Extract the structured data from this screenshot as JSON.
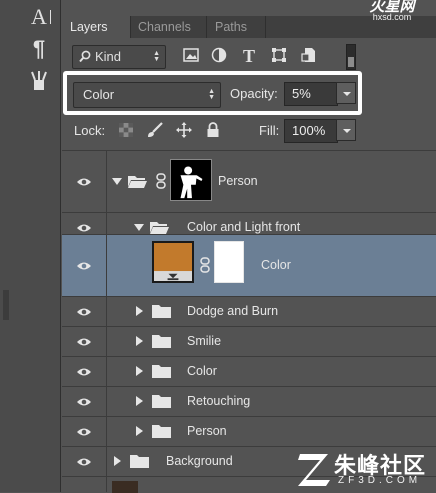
{
  "tools": [
    {
      "name": "type-tool",
      "glyph": "A"
    },
    {
      "name": "paragraph-tool",
      "glyph": "¶"
    },
    {
      "name": "brush-settings-tool",
      "glyph": ""
    }
  ],
  "tabs": [
    {
      "label": "Layers",
      "active": true
    },
    {
      "label": "Channels",
      "active": false
    },
    {
      "label": "Paths",
      "active": false
    }
  ],
  "filter": {
    "kind_label": "Kind",
    "icons": [
      "image-filter-icon",
      "adjustment-filter-icon",
      "type-filter-icon",
      "shape-filter-icon",
      "smart-object-filter-icon"
    ],
    "type_glyph": "T"
  },
  "blend": {
    "mode": "Color",
    "opacity_label": "Opacity:",
    "opacity_value": "5%"
  },
  "lock": {
    "label": "Lock:",
    "fill_label": "Fill:",
    "fill_value": "100%"
  },
  "layers": [
    {
      "name": "Person",
      "kind": "group",
      "expanded": true,
      "level": 0,
      "has_mask": true
    },
    {
      "name": "Color and Light front",
      "kind": "group",
      "expanded": true,
      "level": 1
    },
    {
      "name": "Color",
      "kind": "fill",
      "level": 2,
      "selected": true,
      "fill_color": "#c27a2c"
    },
    {
      "name": "Dodge and Burn",
      "kind": "group",
      "expanded": false,
      "level": 1
    },
    {
      "name": "Smilie",
      "kind": "group",
      "expanded": false,
      "level": 1
    },
    {
      "name": "Color",
      "kind": "group",
      "expanded": false,
      "level": 1
    },
    {
      "name": "Retouching",
      "kind": "group",
      "expanded": false,
      "level": 1
    },
    {
      "name": "Person",
      "kind": "group",
      "expanded": false,
      "level": 1
    },
    {
      "name": "Background",
      "kind": "group",
      "expanded": false,
      "level": 0
    }
  ],
  "watermark": {
    "top_brand": "火星网",
    "top_url": "hxsd.com",
    "bottom_brand": "朱峰社区",
    "bottom_url": "ZF3D.COM"
  },
  "colors": {
    "panel_bg": "#535353",
    "selected_row": "#6b7f95",
    "highlight_border": "#ffffff",
    "color_fill_swatch": "#c27a2c"
  }
}
